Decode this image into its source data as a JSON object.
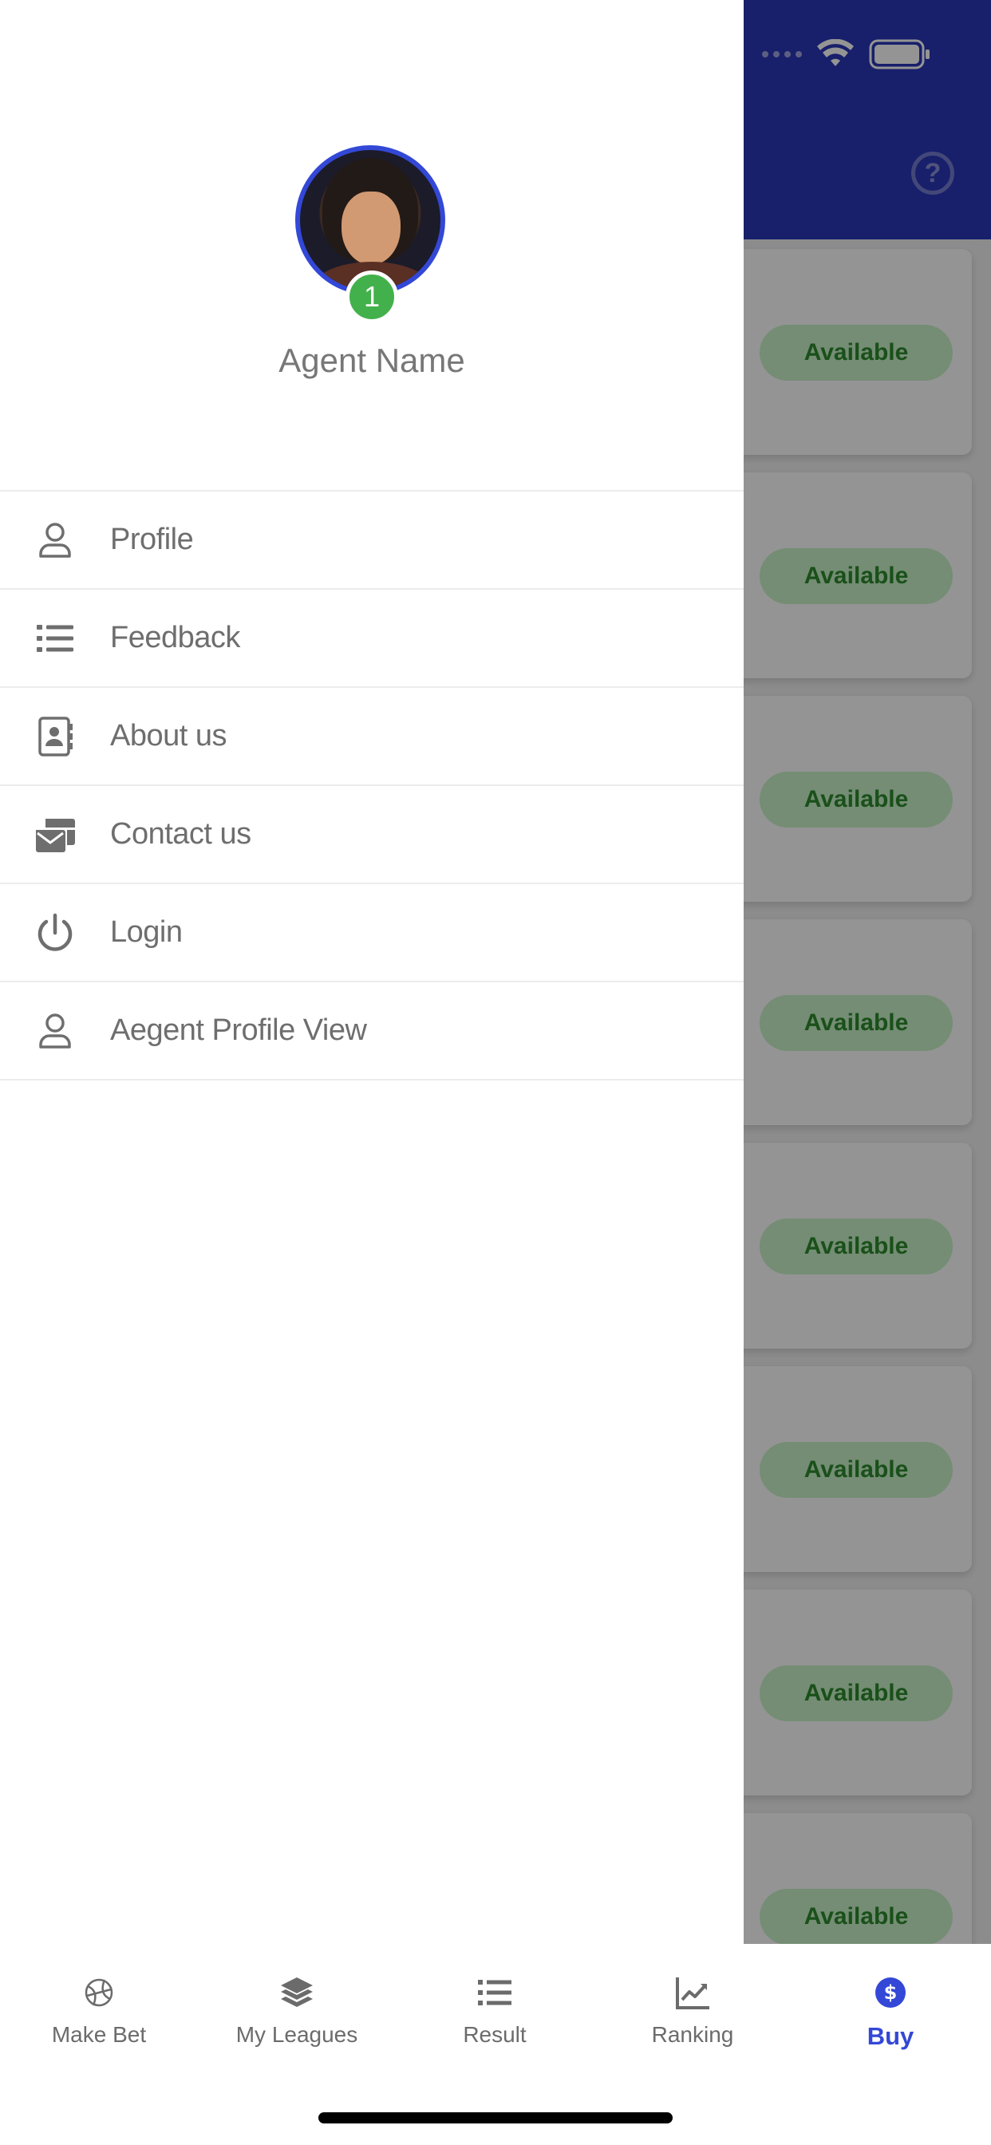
{
  "drawer": {
    "agent_name": "Agent Name",
    "badge_count": "1",
    "menu": [
      {
        "label": "Profile",
        "icon": "user-outline-icon"
      },
      {
        "label": "Feedback",
        "icon": "list-icon"
      },
      {
        "label": "About us",
        "icon": "contact-book-icon"
      },
      {
        "label": "Contact us",
        "icon": "mail-stack-icon"
      },
      {
        "label": "Login",
        "icon": "power-icon"
      },
      {
        "label": "Aegent Profile View",
        "icon": "user-outline-icon"
      }
    ]
  },
  "background": {
    "header_help_icon": "question-circle-icon",
    "card_status": "Available",
    "card_count": 8
  },
  "tabbar": {
    "tabs": [
      {
        "label": "Make Bet",
        "icon": "tennis-ball-icon"
      },
      {
        "label": "My Leagues",
        "icon": "layers-icon"
      },
      {
        "label": "Result",
        "icon": "list-icon"
      },
      {
        "label": "Ranking",
        "icon": "chart-line-icon"
      },
      {
        "label": "Buy",
        "icon": "dollar-circle-icon"
      }
    ],
    "active": "Buy"
  },
  "colors": {
    "header_blue": "#2a36b8",
    "accent_blue": "#3348d6",
    "badge_green": "#43b14b",
    "available_bg": "#c9f3c9",
    "available_text": "#2e8a2e",
    "menu_text": "#6e6e6e"
  }
}
